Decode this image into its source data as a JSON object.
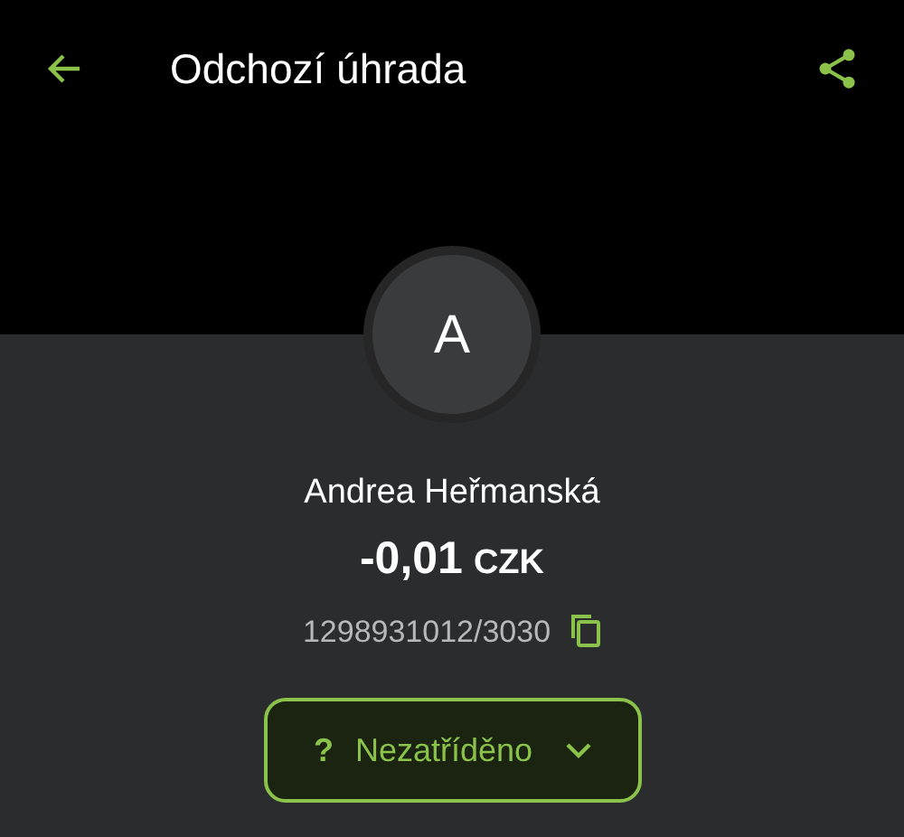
{
  "header": {
    "title": "Odchozí úhrada"
  },
  "avatar": {
    "initial": "A"
  },
  "payee": {
    "name": "Andrea Heřmanská",
    "amount": "-0,01",
    "currency": "CZK",
    "account": "1298931012/3030"
  },
  "category": {
    "icon": "?",
    "label": "Nezatříděno"
  }
}
